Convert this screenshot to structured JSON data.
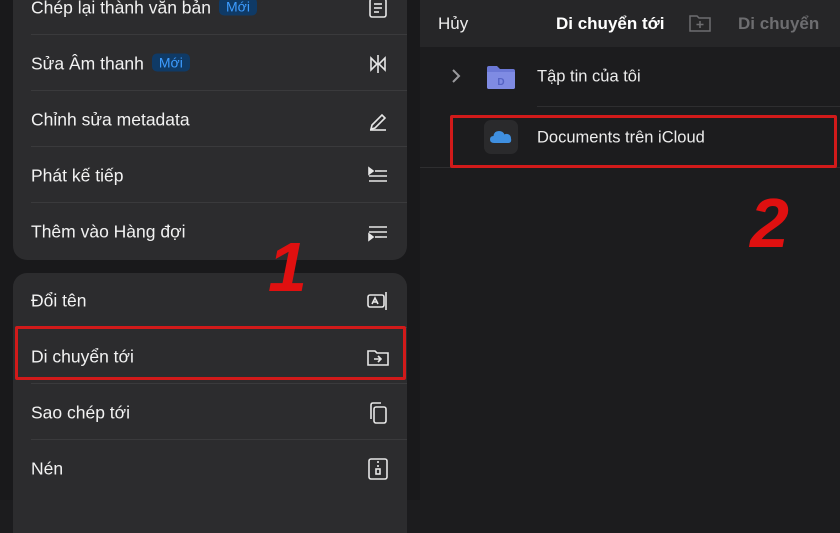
{
  "menu": {
    "group1": [
      {
        "label": "Chép lại thành văn bản",
        "badge": "Mới",
        "icon": "transcript-icon"
      },
      {
        "label": "Sửa Âm thanh",
        "badge": "Mới",
        "icon": "audio-edit-icon"
      },
      {
        "label": "Chỉnh sửa metadata",
        "icon": "pencil-icon"
      },
      {
        "label": "Phát kế tiếp",
        "icon": "play-next-icon"
      },
      {
        "label": "Thêm vào Hàng đợi",
        "icon": "add-to-queue-icon"
      }
    ],
    "group2": [
      {
        "label": "Đổi tên",
        "icon": "rename-icon"
      },
      {
        "label": "Di chuyển tới",
        "icon": "move-folder-icon"
      },
      {
        "label": "Sao chép tới",
        "icon": "copy-icon"
      },
      {
        "label": "Nén",
        "icon": "zip-icon"
      }
    ]
  },
  "picker": {
    "cancel_label": "Hủy",
    "title": "Di chuyển tới",
    "move_label": "Di chuyển",
    "folders": [
      {
        "label": "Tập tin của tôi",
        "icon": "folder-icon"
      },
      {
        "label": "Documents trên iCloud",
        "icon": "icloud-icon"
      }
    ]
  },
  "annotations": {
    "step1": "1",
    "step2": "2",
    "highlight_color": "#d11a1a"
  }
}
